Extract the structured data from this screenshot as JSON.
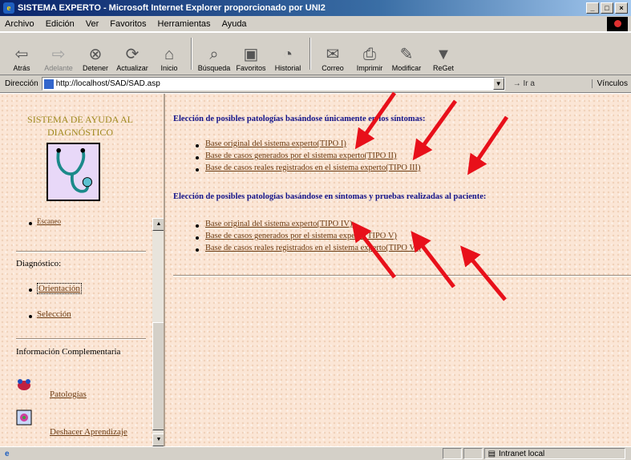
{
  "window": {
    "title": "SISTEMA EXPERTO - Microsoft Internet Explorer proporcionado por UNI2"
  },
  "menu": [
    "Archivo",
    "Edición",
    "Ver",
    "Favoritos",
    "Herramientas",
    "Ayuda"
  ],
  "toolbar": {
    "back": "Atrás",
    "forward": "Adelante",
    "stop": "Detener",
    "refresh": "Actualizar",
    "home": "Inicio",
    "search": "Búsqueda",
    "favorites": "Favoritos",
    "history": "Historial",
    "mail": "Correo",
    "print": "Imprimir",
    "edit": "Modificar",
    "reget": "ReGet"
  },
  "address": {
    "label": "Dirección",
    "url": "http://localhost/SAD/SAD.asp",
    "go": "Ir a",
    "links": "Vínculos"
  },
  "sidebar": {
    "title": "SISTEMA DE AYUDA AL DIAGNÓSTICO",
    "partial_item": "Escaneo",
    "diagnostico_label": "Diagnóstico:",
    "items": [
      "Orientación",
      "Selección"
    ],
    "info_label": "Información Complementaria",
    "links": [
      "Patologías",
      "Deshacer Aprendizaje"
    ]
  },
  "main": {
    "section1_title": "Elección de posibles patologías basándose únicamente en los síntomas:",
    "section1_links": [
      "Base original del sistema experto(TIPO I)",
      "Base de casos generados por el sistema experto(TIPO II)",
      "Base de casos reales registrados en el sistema experto(TIPO III)"
    ],
    "section2_title": "Elección de posibles patologías basándose en síntomas y pruebas realizadas al paciente:",
    "section2_links": [
      "Base original del sistema experto(TIPO IV)",
      "Base de casos generados por el sistema experto(TIPO V)",
      "Base de casos reales registrados en el sistema experto(TIPO VI)"
    ]
  },
  "status": {
    "zone": "Intranet local"
  },
  "colors": {
    "background": "#fbe6d6",
    "link": "#6b3a10",
    "heading": "#14148a",
    "arrow": "#e8101a"
  }
}
